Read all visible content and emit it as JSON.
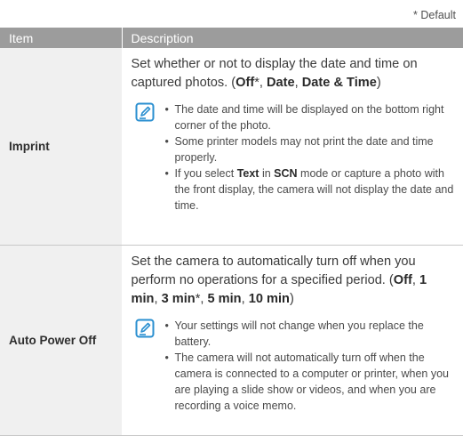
{
  "header_note": "* Default",
  "table": {
    "col_item": "Item",
    "col_description": "Description"
  },
  "rows": [
    {
      "item": "Imprint",
      "desc_1": "Set whether or not to display the date and time on captured photos. (",
      "opt_1": "Off",
      "opt_1_mark": "*",
      "sep_1": ", ",
      "opt_2": "Date",
      "sep_2": ", ",
      "opt_3": "Date & Time",
      "desc_end": ")",
      "notes": [
        {
          "text": "The date and time will be displayed on the bottom right corner of the photo."
        },
        {
          "text": "Some printer models may not print the date and time properly."
        },
        {
          "pre": "If you select ",
          "bold_1": "Text",
          "mid": " in ",
          "bold_2": "SCN",
          "post": " mode or capture a photo with the front display, the camera will not display the date and time."
        }
      ]
    },
    {
      "item": "Auto Power Off",
      "desc_1": "Set the camera to automatically turn off when you perform no operations for a specified period. (",
      "opt_1": "Off",
      "sep_1": ", ",
      "opt_2": "1 min",
      "sep_2": ", ",
      "opt_3": "3 min",
      "opt_3_mark": "*",
      "sep_3": ", ",
      "opt_4": "5 min",
      "sep_4": ", ",
      "opt_5": "10 min",
      "desc_end": ")",
      "notes": [
        {
          "text": "Your settings will not change when you replace the battery."
        },
        {
          "text": "The camera will not automatically turn off when the camera is connected to a computer or printer, when you are playing a slide show or videos, and when you are recording a voice memo."
        }
      ]
    }
  ]
}
